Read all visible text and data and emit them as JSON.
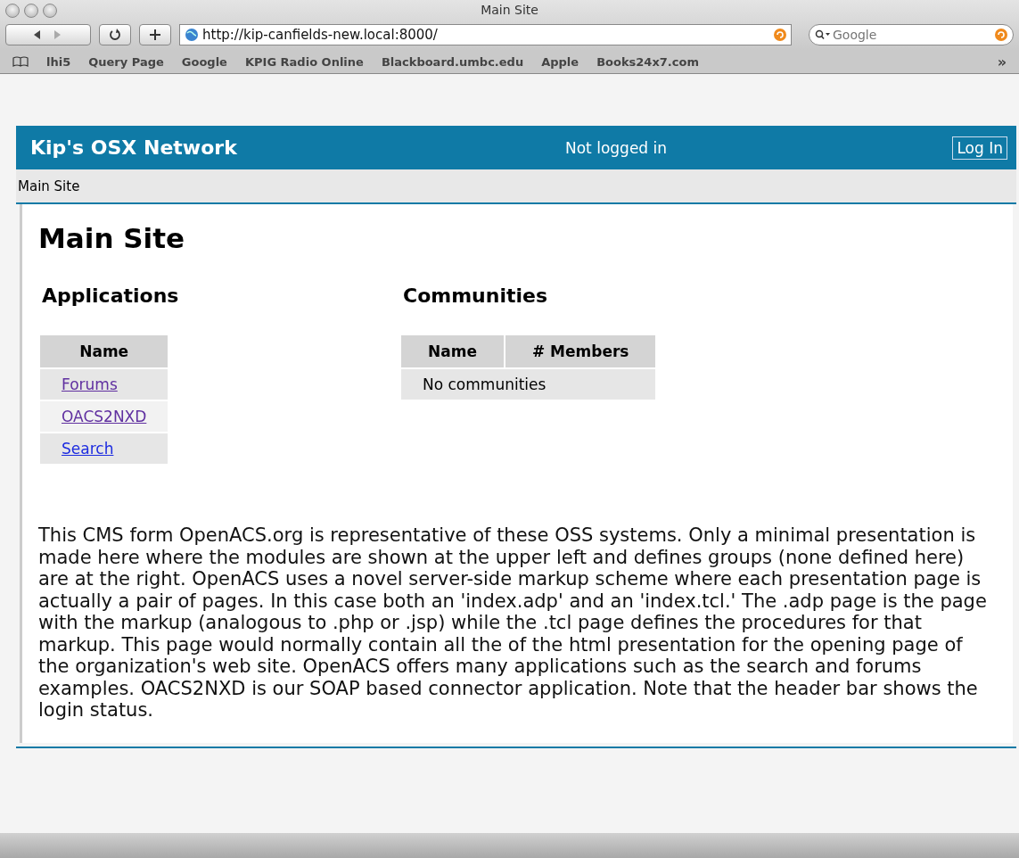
{
  "window": {
    "title": "Main Site"
  },
  "toolbar": {
    "url": "http://kip-canfields-new.local:8000/",
    "search_placeholder": "Google"
  },
  "bookmarks": [
    "lhi5",
    "Query Page",
    "Google",
    "KPIG Radio Online",
    "Blackboard.umbc.edu",
    "Apple",
    "Books24x7.com"
  ],
  "bookmarks_overflow": "»",
  "header": {
    "site_name": "Kip's OSX Network",
    "login_status": "Not logged in",
    "login_button": "Log In"
  },
  "breadcrumb": "Main Site",
  "page_title": "Main Site",
  "applications": {
    "heading": "Applications",
    "column": "Name",
    "rows": [
      {
        "label": "Forums",
        "visited": true
      },
      {
        "label": "OACS2NXD",
        "visited": true
      },
      {
        "label": "Search",
        "visited": false
      }
    ]
  },
  "communities": {
    "heading": "Communities",
    "columns": [
      "Name",
      "# Members"
    ],
    "empty_message": "No communities"
  },
  "description": "This CMS form OpenACS.org is representative of these OSS systems. Only a minimal presentation is made here where the modules are shown at the upper left and defines groups (none defined here) are at the right. OpenACS uses a novel server-side markup scheme where each presentation page is actually a pair of pages. In this case both an 'index.adp' and an 'index.tcl.' The .adp page is the page with the markup (analogous to .php or .jsp) while the .tcl page defines the procedures for that markup. This page would normally contain all the of the html presentation for the opening page of the organization's web site. OpenACS offers many applications such as the search and forums examples. OACS2NXD is our SOAP based connector application. Note that the header bar shows the login status."
}
